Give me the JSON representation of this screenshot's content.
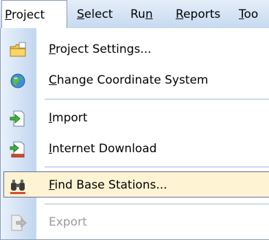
{
  "menubar": {
    "items": [
      {
        "mnemonic": "P",
        "rest": "roject"
      },
      {
        "mnemonic": "S",
        "rest": "elect"
      },
      {
        "pre": "Ru",
        "mnemonic": "n"
      },
      {
        "mnemonic": "R",
        "rest": "eports"
      },
      {
        "mnemonic": "T",
        "rest": "oo"
      }
    ]
  },
  "menu": {
    "items": [
      {
        "mnemonic": "P",
        "rest": "roject Settings...",
        "icon": "folder-settings-icon"
      },
      {
        "mnemonic": "C",
        "rest": "hange Coordinate System",
        "icon": "globe-icon"
      },
      {
        "mnemonic": "I",
        "rest": "mport",
        "icon": "import-icon"
      },
      {
        "mnemonic": "I",
        "rest": "nternet Download",
        "icon": "internet-download-icon"
      },
      {
        "mnemonic": "F",
        "rest": "ind Base Stations...",
        "icon": "binoculars-icon"
      },
      {
        "mnemonic": "",
        "rest": "Export",
        "icon": "export-icon",
        "disabled": true
      }
    ]
  },
  "colors": {
    "menubar_top": "#e4eef9",
    "menubar_bottom": "#c6d9f0",
    "highlight_fill": "#fef3d3",
    "highlight_border": "#5c6f97",
    "disabled_text": "#9b9b9b"
  }
}
